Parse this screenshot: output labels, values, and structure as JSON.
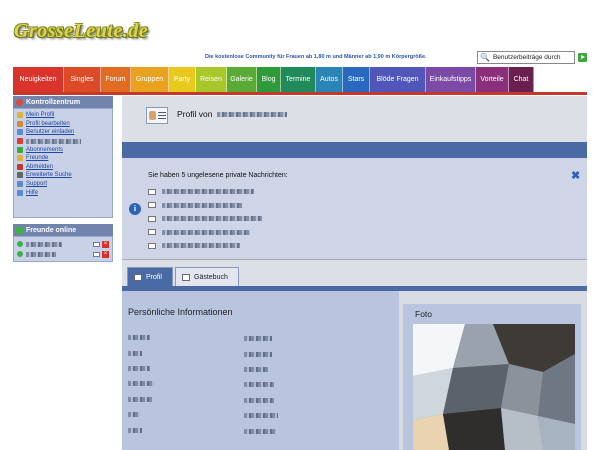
{
  "site": {
    "logo": "GrosseLeute.de",
    "tagline": "Die kostenlose Community für Frauen ab 1,80 m und Männer ab 1,90 m Körpergröße."
  },
  "search": {
    "value": "Benutzerbeiträge durch"
  },
  "nav": [
    {
      "label": "Neuigkeiten",
      "color": "#d8342c"
    },
    {
      "label": "Singles",
      "color": "#dc4a27"
    },
    {
      "label": "Forum",
      "color": "#e06d22"
    },
    {
      "label": "Gruppen",
      "color": "#e8a21d"
    },
    {
      "label": "Party",
      "color": "#e8c91e"
    },
    {
      "label": "Reisen",
      "color": "#a8c72a"
    },
    {
      "label": "Galerie",
      "color": "#5aaa35"
    },
    {
      "label": "Blog",
      "color": "#2e9a3a"
    },
    {
      "label": "Termine",
      "color": "#218a5a"
    },
    {
      "label": "Autos",
      "color": "#2a84b5"
    },
    {
      "label": "Stars",
      "color": "#2a68c0"
    },
    {
      "label": "Blöde Fragen",
      "color": "#5057b8"
    },
    {
      "label": "Einkaufstipps",
      "color": "#7a4aa5"
    },
    {
      "label": "Vorteile",
      "color": "#8a2f7a"
    },
    {
      "label": "Chat",
      "color": "#6b1f4e"
    }
  ],
  "sidebar": {
    "control_title": "Kontrollzentrum",
    "items": [
      {
        "label": "Mein Profil",
        "icon": "profile-icon"
      },
      {
        "label": "Profil bearbeiten",
        "icon": "edit-icon"
      },
      {
        "label": "Benutzer einladen",
        "icon": "invite-icon"
      },
      {
        "label": "",
        "icon": "mail-icon"
      },
      {
        "label": "Abonnements",
        "icon": "check-icon"
      },
      {
        "label": "Freunde",
        "icon": "friends-icon"
      },
      {
        "label": "Abmelden",
        "icon": "logout-icon"
      },
      {
        "label": "Erweiterte Suche",
        "icon": "search-icon"
      },
      {
        "label": "Support",
        "icon": "support-icon"
      },
      {
        "label": "Hilfe",
        "icon": "help-icon"
      }
    ],
    "friends_title": "Freunde online"
  },
  "profile": {
    "title": "Profil von"
  },
  "messages": {
    "text": "Sie haben 5 ungelesene private Nachrichten:",
    "count": 5
  },
  "tabs": [
    {
      "label": "Profil"
    },
    {
      "label": "Gästebuch"
    }
  ],
  "info": {
    "title": "Persönliche Informationen",
    "row_count": 7
  },
  "foto": {
    "title": "Foto"
  }
}
